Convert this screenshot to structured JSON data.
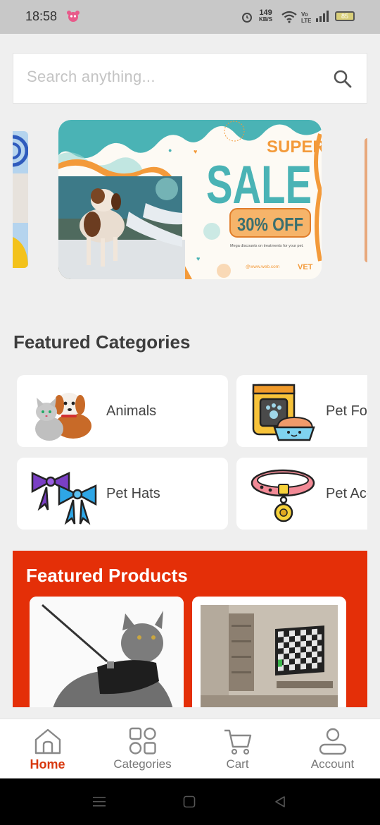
{
  "status": {
    "time": "18:58",
    "speed_value": "149",
    "speed_unit": "KB/S",
    "battery": "85"
  },
  "search": {
    "placeholder": "Search anything..."
  },
  "banner": {
    "headline_small": "SUPER",
    "headline_big": "SALE",
    "discount": "30% OFF",
    "subtext": "Mega discounts on treatments for your pet.",
    "website": "@www.web.com",
    "brand": "VET"
  },
  "categories": {
    "title": "Featured Categories",
    "items": [
      {
        "label": "Animals"
      },
      {
        "label": "Pet Food"
      },
      {
        "label": "Pet Hats"
      },
      {
        "label": "Pet Accessories"
      }
    ]
  },
  "featured_products": {
    "title": "Featured Products"
  },
  "bottom_nav": {
    "items": [
      {
        "label": "Home",
        "active": true
      },
      {
        "label": "Categories",
        "active": false
      },
      {
        "label": "Cart",
        "active": false
      },
      {
        "label": "Account",
        "active": false
      }
    ]
  },
  "colors": {
    "accent": "#d8380e",
    "featured_bg": "#e42f08",
    "banner_teal": "#4ab3b5",
    "banner_orange": "#f39a3a"
  }
}
